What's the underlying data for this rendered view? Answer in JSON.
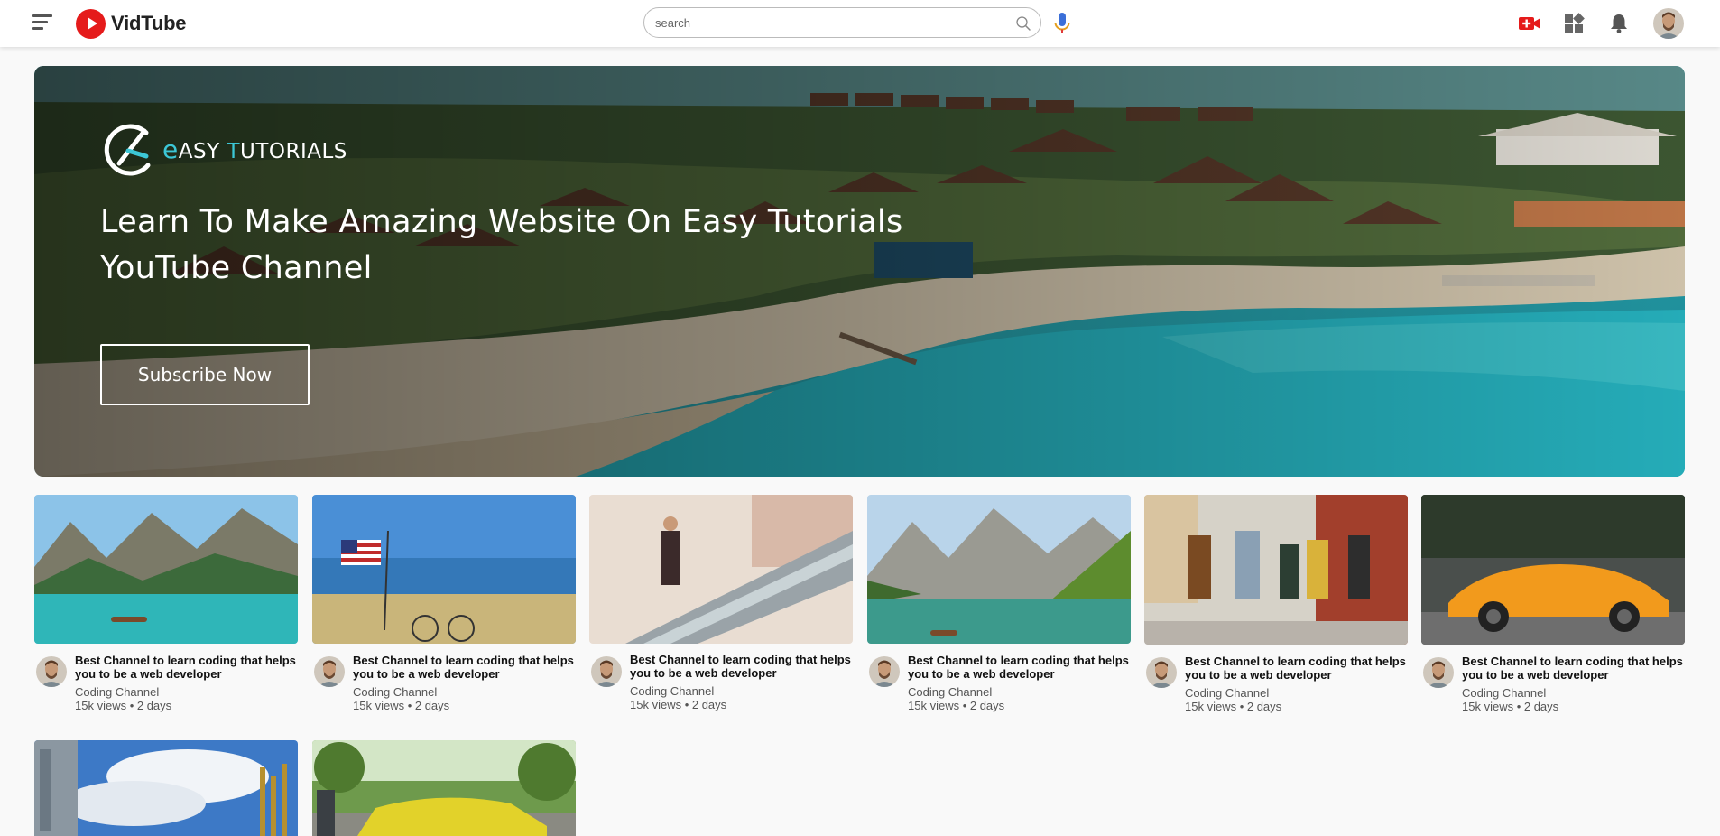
{
  "app": {
    "name": "VidTube"
  },
  "search": {
    "placeholder": "search"
  },
  "banner": {
    "logo_e": "e",
    "logo_rest_1": "ASY ",
    "logo_t": "T",
    "logo_rest_2": "UTORIALS",
    "title_line1": "Learn To Make Amazing Website On Easy Tutorials",
    "title_line2": "YouTube Channel",
    "button_label": "Subscribe Now"
  },
  "videos": [
    {
      "title": "Best Channel to learn coding that helps you to be a web developer",
      "channel": "Coding Channel",
      "meta": "15k views • 2 days"
    },
    {
      "title": "Best Channel to learn coding that helps you to be a web developer",
      "channel": "Coding Channel",
      "meta": "15k views • 2 days"
    },
    {
      "title": "Best Channel to learn coding that helps you to be a web developer",
      "channel": "Coding Channel",
      "meta": "15k views • 2 days"
    },
    {
      "title": "Best Channel to learn coding that helps you to be a web developer",
      "channel": "Coding Channel",
      "meta": "15k views • 2 days"
    },
    {
      "title": "Best Channel to learn coding that helps you to be a web developer",
      "channel": "Coding Channel",
      "meta": "15k views • 2 days"
    },
    {
      "title": "Best Channel to learn coding that helps you to be a web developer",
      "channel": "Coding Channel",
      "meta": "15k views • 2 days"
    }
  ],
  "icons": {
    "menu": "menu-icon",
    "logo": "play-logo-icon",
    "search": "search-icon",
    "mic": "microphone-icon",
    "upload": "video-upload-icon",
    "apps": "apps-grid-icon",
    "notifications": "bell-icon",
    "profile": "avatar"
  },
  "colors": {
    "brand": "#e51b1b",
    "accent": "#3cc7d6"
  }
}
